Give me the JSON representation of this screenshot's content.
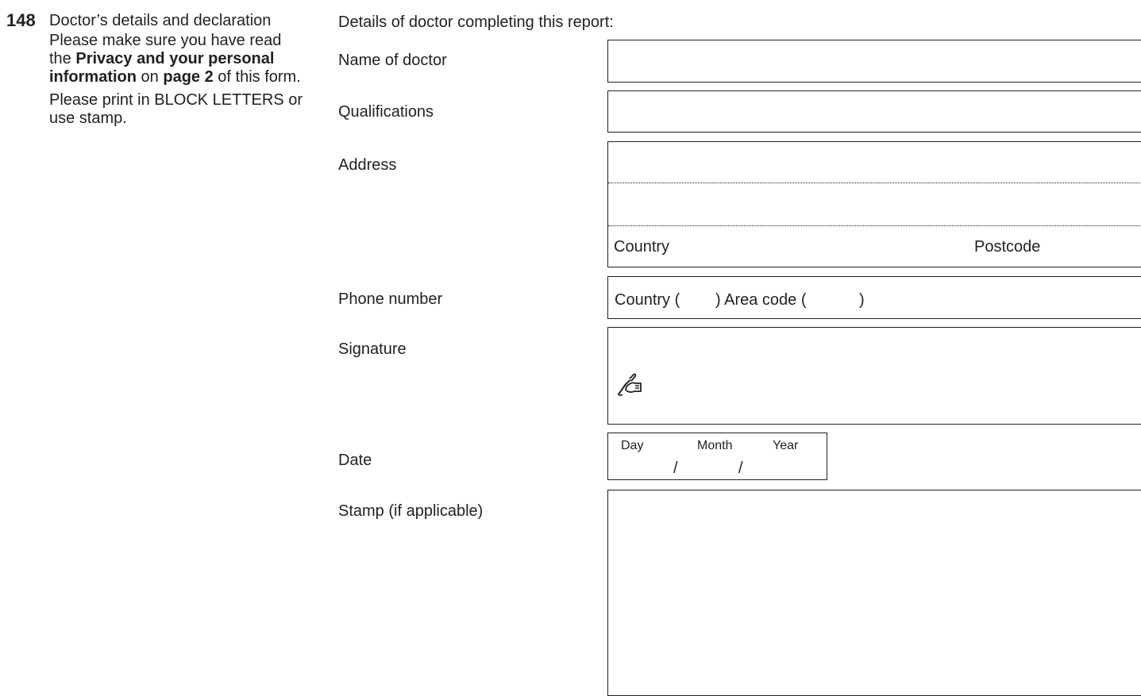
{
  "section": {
    "number": "148",
    "title": "Doctor’s details and declaration",
    "instructions": {
      "line1_pre": "Please make sure you have read the ",
      "privacy_link": "Privacy and your personal information",
      "line1_mid": " on ",
      "page_ref": "page 2",
      "line1_post": " of this form.",
      "line2": "Please print in BLOCK LETTERS or use stamp."
    }
  },
  "form": {
    "intro": "Details of doctor completing this report:",
    "name_label": "Name of doctor",
    "name_value": "",
    "qualifications_label": "Qualifications",
    "qualifications_value": "",
    "address": {
      "label": "Address",
      "line1": "",
      "line2": "",
      "country_label": "Country",
      "postcode_label": "Postcode"
    },
    "phone": {
      "label": "Phone number",
      "country_prefix": "Country (",
      "area_prefix": ") Area code (",
      "area_suffix": ")"
    },
    "signature": {
      "label": "Signature",
      "icon": "pen-hand-icon"
    },
    "date": {
      "label": "Date",
      "day": "Day",
      "month": "Month",
      "year": "Year",
      "separator": "/"
    },
    "stamp_label": "Stamp (if applicable)"
  }
}
